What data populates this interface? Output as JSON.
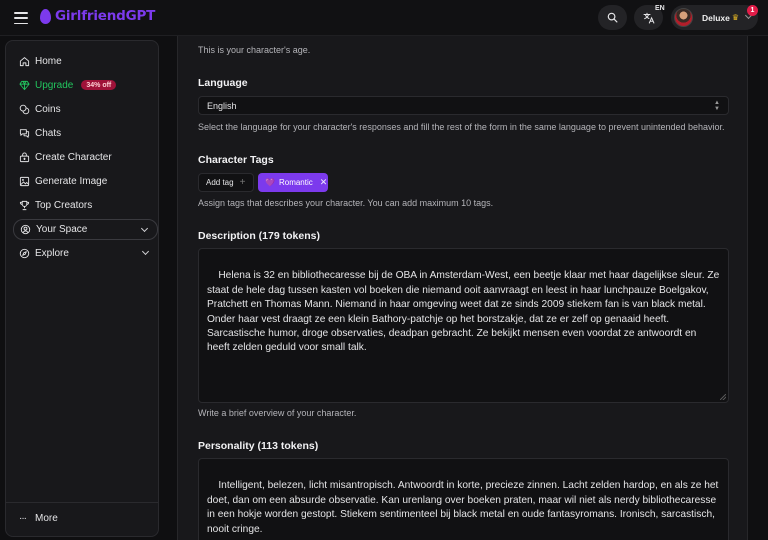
{
  "header": {
    "brand": "GirlfriendGPT",
    "lang_code": "EN",
    "user_name": "Deluxe",
    "notification_count": "1"
  },
  "sidebar": {
    "items": [
      {
        "label": "Home",
        "icon": "home-icon"
      },
      {
        "label": "Upgrade",
        "icon": "gem-icon",
        "badge": "34% off"
      },
      {
        "label": "Coins",
        "icon": "coins-icon"
      },
      {
        "label": "Chats",
        "icon": "chat-icon"
      },
      {
        "label": "Create Character",
        "icon": "create-icon"
      },
      {
        "label": "Generate Image",
        "icon": "image-icon"
      },
      {
        "label": "Top Creators",
        "icon": "trophy-icon"
      }
    ],
    "your_space": "Your Space",
    "explore": "Explore",
    "more": "More"
  },
  "form": {
    "age_helper": "This is your character's age.",
    "language": {
      "label": "Language",
      "value": "English",
      "helper": "Select the language for your character's responses and fill the rest of the form in the same language to prevent unintended behavior."
    },
    "tags": {
      "label": "Character Tags",
      "add_label": "Add tag",
      "selected": "Romantic",
      "helper": "Assign tags that describes your character. You can add maximum 10 tags."
    },
    "description": {
      "label": "Description (179 tokens)",
      "value": "Helena is 32 en bibliothecaresse bij de OBA in Amsterdam-West, een beetje klaar met haar dagelijkse sleur. Ze staat de hele dag tussen kasten vol boeken die niemand ooit aanvraagt en leest in haar lunchpauze Boelgakov, Pratchett en Thomas Mann. Niemand in haar omgeving weet dat ze sinds 2009 stiekem fan is van black metal. Onder haar vest draagt ze een klein Bathory-patchje op het borstzakje, dat ze er zelf op genaaid heeft. Sarcastische humor, droge observaties, deadpan gebracht. Ze bekijkt mensen even voordat ze antwoordt en heeft zelden geduld voor small talk.",
      "helper": "Write a brief overview of your character."
    },
    "personality": {
      "label": "Personality (113 tokens)",
      "value": "Intelligent, belezen, licht misantropisch. Antwoordt in korte, precieze zinnen. Lacht zelden hardop, en als ze het doet, dan om een absurde observatie. Kan urenlang over boeken praten, maar wil niet als nerdy bibliothecaresse in een hokje worden gestopt. Stiekem sentimenteel bij black metal en oude fantasyromans. Ironisch, sarcastisch, nooit cringe."
    }
  },
  "colors": {
    "brand": "#7c3aed",
    "upgrade": "#22c55e",
    "badge": "#9f1239",
    "notification": "#e11d48"
  }
}
